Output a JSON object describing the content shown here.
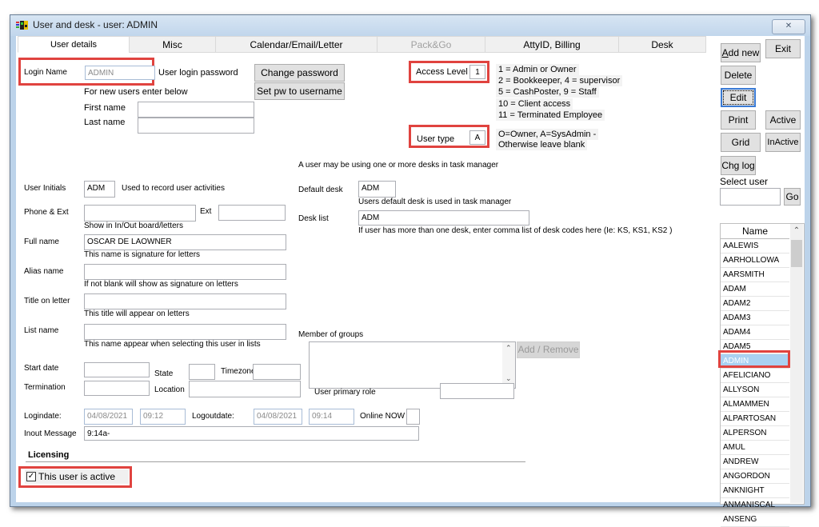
{
  "window": {
    "title": "User and desk - user: ADMIN",
    "close_glyph": "✕"
  },
  "tabs": [
    {
      "label": "User details",
      "state": "active"
    },
    {
      "label": "Misc",
      "state": "normal"
    },
    {
      "label": "Calendar/Email/Letter",
      "state": "normal"
    },
    {
      "label": "Pack&Go",
      "state": "disabled"
    },
    {
      "label": "AttyID, Billing",
      "state": "normal"
    },
    {
      "label": "Desk",
      "state": "normal"
    }
  ],
  "login": {
    "label": "Login Name",
    "value": "ADMIN",
    "password_label": "User login password",
    "change_password": "Change password",
    "set_pw_username": "Set pw to username",
    "new_users_hint": "For new users enter below",
    "first_name_label": "First name",
    "first_name_value": "",
    "last_name_label": "Last name",
    "last_name_value": ""
  },
  "access": {
    "label": "Access Level",
    "value": "1",
    "legend": [
      "1 = Admin or Owner",
      "2 = Bookkeeper, 4 = supervisor",
      "5 = CashPoster, 9 = Staff",
      "10 = Client access",
      "11 = Terminated Employee"
    ]
  },
  "user_type": {
    "label": "User type",
    "value": "A",
    "legend": [
      "O=Owner, A=SysAdmin -",
      "Otherwise leave blank"
    ]
  },
  "fields": {
    "initials_label": "User Initials",
    "initials_value": "ADM",
    "initials_hint": "Used to record user activities",
    "phone_label": "Phone & Ext",
    "phone_value": "",
    "ext_label": "Ext",
    "ext_value": "",
    "phone_hint": "Show in In/Out board/letters",
    "fullname_label": "Full name",
    "fullname_value": "OSCAR DE LAOWNER",
    "fullname_hint": "This name is signature for letters",
    "alias_label": "Alias name",
    "alias_value": "",
    "alias_hint": "If not blank will show as signature on letters",
    "title_label": "Title on letter",
    "title_value": "",
    "title_hint": "This title will  appear on letters",
    "listname_label": "List name",
    "listname_value": "",
    "listname_hint": "This name appear when selecting this user in lists",
    "start_label": "Start date",
    "start_value": "",
    "state_label": "State",
    "state_value": "",
    "timezone_label": "Timezone",
    "timezone_value": "",
    "termination_label": "Termination",
    "termination_value": "",
    "location_label": "Location",
    "location_value": "",
    "logindate_label": "Logindate:",
    "logindate_value": "04/08/2021",
    "logintime_value": "09:12",
    "logoutdate_label": "Logoutdate:",
    "logoutdate_value": "04/08/2021",
    "logouttime_value": "09:14",
    "online_label": "Online NOW",
    "inout_label": "Inout Message",
    "inout_value": "9:14a-"
  },
  "desk": {
    "intro": "A user may be using one or more desks in task manager",
    "default_label": "Default desk",
    "default_value": "ADM",
    "default_hint": "Users default desk is used in task manager",
    "list_label": "Desk list",
    "list_value": "ADM",
    "list_hint": "If user has more than one desk, enter comma list of desk codes here (Ie:  KS, KS1, KS2 )",
    "groups_label": "Member of groups",
    "groups_button": "Add / Remove",
    "role_label": "User primary role",
    "role_value": ""
  },
  "licensing": {
    "heading": "Licensing",
    "active_label": "This user is active",
    "active_checked": true
  },
  "side": {
    "add_new": "Add new",
    "exit": "Exit",
    "delete": "Delete",
    "edit": "Edit",
    "print": "Print",
    "active": "Active",
    "grid": "Grid",
    "inactive": "InActive",
    "chg_log": "Chg log",
    "select_user_label": "Select user",
    "select_user_value": "",
    "go": "Go",
    "column_header": "Name",
    "users": [
      "AALEWIS",
      "AARHOLLOWA",
      "AARSMITH",
      "ADAM",
      "ADAM2",
      "ADAM3",
      "ADAM4",
      "ADAM5",
      "ADMIN",
      "AFELICIANO",
      "ALLYSON",
      "ALMAMMEN",
      "ALPARTOSAN",
      "ALPERSON",
      "AMUL",
      "ANDREW",
      "ANGORDON",
      "ANKNIGHT",
      "ANMANISCAL",
      "ANSENG"
    ],
    "selected_user": "ADMIN"
  }
}
